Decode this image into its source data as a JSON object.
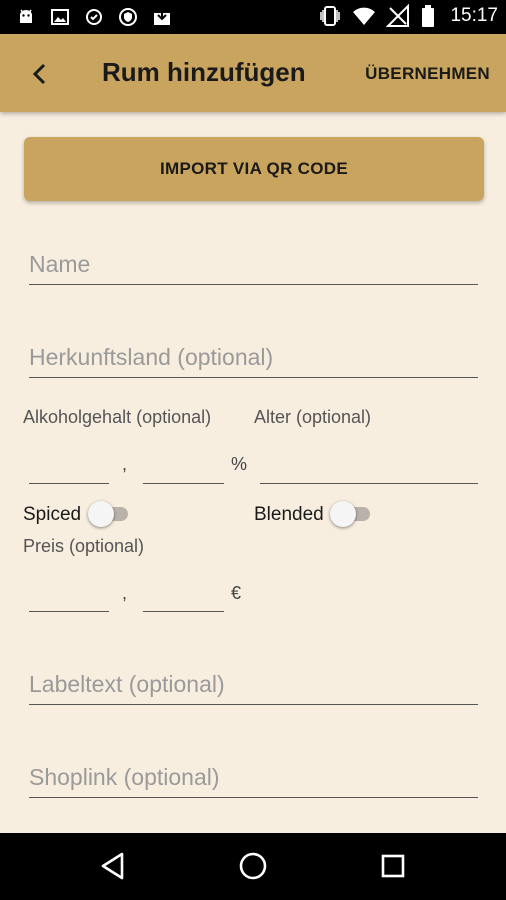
{
  "status_bar": {
    "time": "15:17",
    "left_icons": [
      "android-icon",
      "image-icon",
      "sync-icon",
      "shield-icon",
      "download-icon"
    ],
    "right_icons": [
      "vibrate-icon",
      "wifi-icon",
      "no-signal-icon",
      "battery-icon"
    ]
  },
  "app_bar": {
    "title": "Rum hinzufügen",
    "action_label": "ÜBERNEHMEN",
    "back_icon": "arrow-back-icon",
    "color": "#c9a45e"
  },
  "qr_button": {
    "label": "IMPORT VIA QR CODE"
  },
  "fields": {
    "name_placeholder": "Name",
    "country_placeholder": "Herkunftsland (optional)",
    "alcohol_label": "Alkoholgehalt (optional)",
    "age_label": "Alter (optional)",
    "decimal_separator": ",",
    "percent_unit": "%",
    "price_label": "Preis (optional)",
    "currency_unit": "€",
    "label_text_placeholder": "Labeltext (optional)",
    "shoplink_placeholder": "Shoplink (optional)"
  },
  "switches": {
    "spiced": {
      "label": "Spiced",
      "checked": false
    },
    "blended": {
      "label": "Blended",
      "checked": false
    }
  },
  "nav_bar": {
    "icons": [
      "nav-back-icon",
      "nav-home-icon",
      "nav-recents-icon"
    ]
  },
  "colors": {
    "background": "#f8eee0",
    "accent": "#c9a45e"
  }
}
